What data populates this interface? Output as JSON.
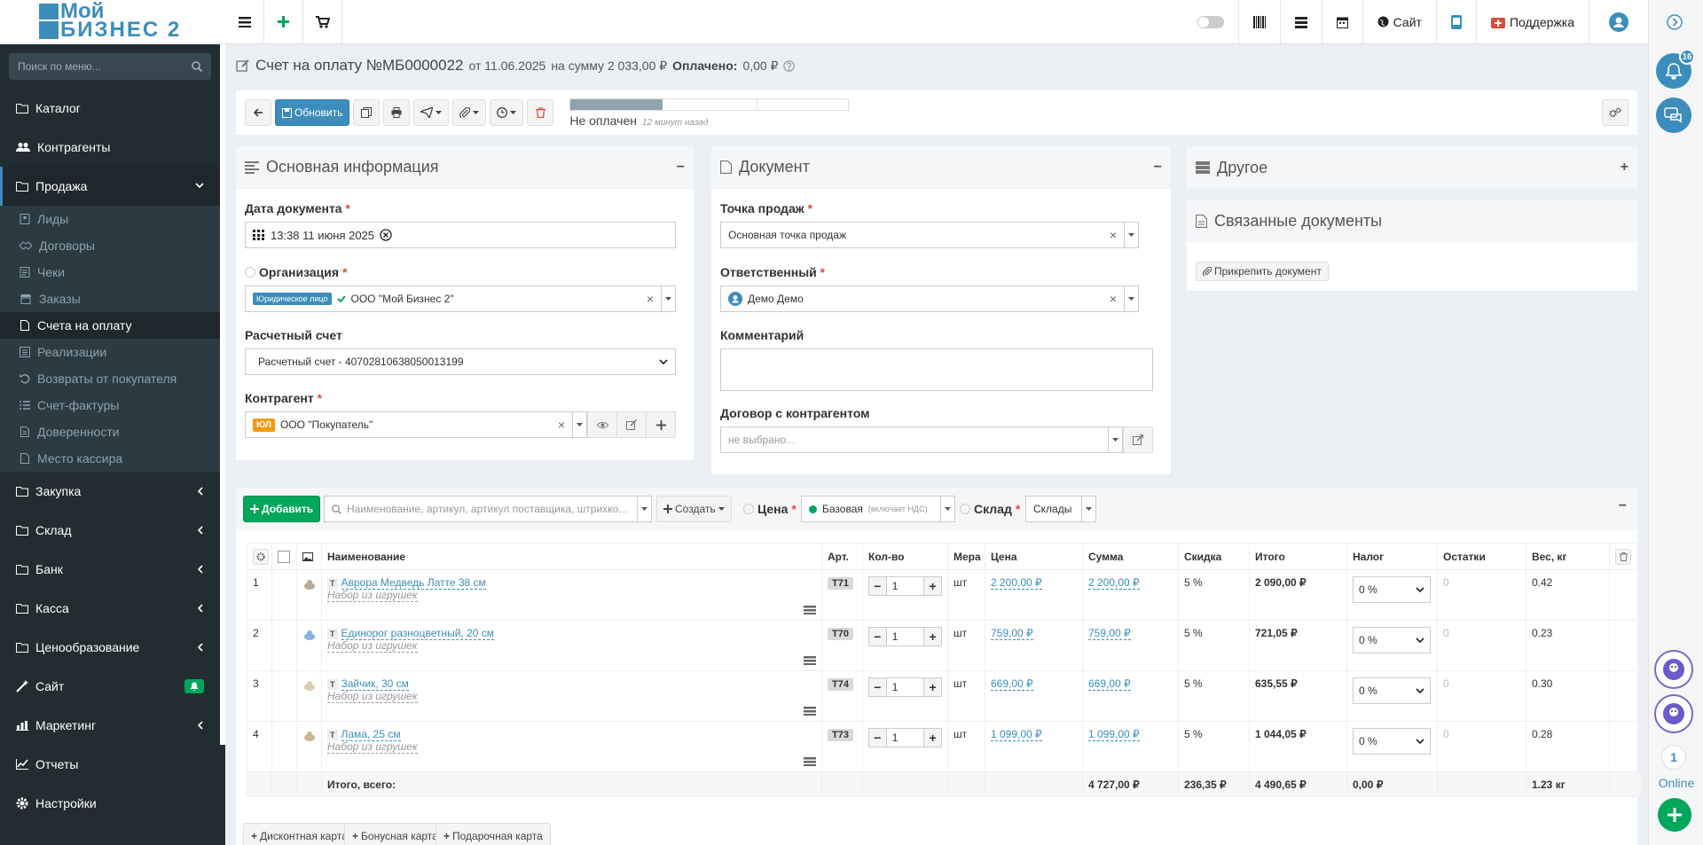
{
  "brand": {
    "line1": "Мой",
    "line2": "Бизнес 2",
    "colors": {
      "primary": "#3c8dbc",
      "success": "#00a65a",
      "danger": "#dd4b39",
      "warning": "#f39c12",
      "sidebar": "#222d32"
    }
  },
  "topbar": {
    "site_label": "Сайт",
    "support_label": "Поддержка"
  },
  "sidebar": {
    "search_placeholder": "Поиск по меню...",
    "items": [
      {
        "label": "Каталог",
        "icon": "folder-icon"
      },
      {
        "label": "Контрагенты",
        "icon": "users-icon"
      },
      {
        "label": "Продажа",
        "icon": "folder-icon",
        "open": true
      },
      {
        "label": "Закупка",
        "icon": "folder-icon"
      },
      {
        "label": "Склад",
        "icon": "folder-icon"
      },
      {
        "label": "Банк",
        "icon": "folder-icon"
      },
      {
        "label": "Касса",
        "icon": "folder-icon"
      },
      {
        "label": "Ценообразование",
        "icon": "folder-icon"
      },
      {
        "label": "Сайт",
        "icon": "wand-icon"
      },
      {
        "label": "Маркетинг",
        "icon": "chart-icon"
      },
      {
        "label": "Отчеты",
        "icon": "line-chart-icon"
      },
      {
        "label": "Настройки",
        "icon": "gear-icon"
      }
    ],
    "sale_subitems": [
      "Лиды",
      "Договоры",
      "Чеки",
      "Заказы",
      "Счета на оплату",
      "Реализации",
      "Возвраты от покупателя",
      "Счет-фактуры",
      "Доверенности",
      "Место кассира"
    ],
    "active_subitem": "Счета на оплату"
  },
  "header": {
    "title": "Счет на оплату №МБ0000022",
    "date_text": "от 11.06.2025",
    "sum_text": "на сумму 2 033,00 ₽",
    "paid_label": "Оплачено:",
    "paid_value": "0,00 ₽"
  },
  "toolbar": {
    "refresh_label": "Обновить",
    "status_text": "Не оплачен",
    "time_ago": "12 минут назад",
    "progress": 0.33
  },
  "main_info": {
    "title": "Основная информация",
    "doc_date_label": "Дата документа",
    "doc_date_value": "13:38 11 июня 2025",
    "org_label": "Организация",
    "org_tag": "Юридическое лицо",
    "org_value": "ООО \"Мой Бизнес 2\"",
    "account_label": "Расчетный счет",
    "account_value": "Расчетный счет - 40702810638050013199",
    "counterparty_label": "Контрагент",
    "counterparty_tag": "ЮЛ",
    "counterparty_value": "ООО \"Покупатель\""
  },
  "document": {
    "title": "Документ",
    "pos_label": "Точка продаж",
    "pos_value": "Основная точка продаж",
    "responsible_label": "Ответственный",
    "responsible_value": "Демо Демо",
    "comment_label": "Комментарий",
    "comment_value": "",
    "contract_label": "Договор с контрагентом",
    "contract_placeholder": "не выбрано..."
  },
  "other": {
    "title": "Другое"
  },
  "linked": {
    "title": "Связанные документы",
    "attach_label": "Прикрепить документ"
  },
  "products": {
    "add_label": "Добавить",
    "search_placeholder": "Наименование, артикул, артикул поставщика, штрихкод...",
    "create_label": "Создать",
    "price_label": "Цена",
    "price_value": "Базовая",
    "price_note": "(включает НДС)",
    "warehouse_label": "Склад",
    "warehouse_value": "Склады",
    "columns": [
      "Наименование",
      "Арт.",
      "Кол-во",
      "Мера",
      "Цена",
      "Сумма",
      "Скидка",
      "Итого",
      "Налог",
      "Остатки",
      "Вес, кг"
    ],
    "rows": [
      {
        "n": "1",
        "type": "Т",
        "name": "Аврора Медведь Латте 38 см",
        "group": "Набор из игрушек",
        "art": "T71",
        "qty": "1",
        "unit": "шт",
        "price": "2 200,00 ₽",
        "sum": "2 200,00 ₽",
        "discount": "5 %",
        "total": "2 090,00 ₽",
        "tax": "0 %",
        "stock": "0",
        "weight": "0.42"
      },
      {
        "n": "2",
        "type": "Т",
        "name": "Единорог разноцветный, 20 см",
        "group": "Набор из игрушек",
        "art": "T70",
        "qty": "1",
        "unit": "шт",
        "price": "759,00 ₽",
        "sum": "759,00 ₽",
        "discount": "5 %",
        "total": "721,05 ₽",
        "tax": "0 %",
        "stock": "0",
        "weight": "0.23"
      },
      {
        "n": "3",
        "type": "Т",
        "name": "Зайчик, 30 см",
        "group": "Набор из игрушек",
        "art": "T74",
        "qty": "1",
        "unit": "шт",
        "price": "669,00 ₽",
        "sum": "669,00 ₽",
        "discount": "5 %",
        "total": "635,55 ₽",
        "tax": "0 %",
        "stock": "0",
        "weight": "0.30"
      },
      {
        "n": "4",
        "type": "Т",
        "name": "Лама, 25 см",
        "group": "Набор из игрушек",
        "art": "T73",
        "qty": "1",
        "unit": "шт",
        "price": "1 099,00 ₽",
        "sum": "1 099,00 ₽",
        "discount": "5 %",
        "total": "1 044,05 ₽",
        "tax": "0 %",
        "stock": "0",
        "weight": "0.28"
      }
    ],
    "totals": {
      "label": "Итого, всего:",
      "sum": "4 727,00 ₽",
      "discount": "236,35 ₽",
      "total": "4 490,65 ₽",
      "tax": "0,00 ₽",
      "weight": "1.23 кг"
    }
  },
  "bottom_buttons": [
    "Дисконтная карта",
    "Бонусная карта",
    "Подарочная карта"
  ],
  "rail": {
    "notif_count": "16",
    "online_count": "1",
    "online_label": "Online"
  }
}
